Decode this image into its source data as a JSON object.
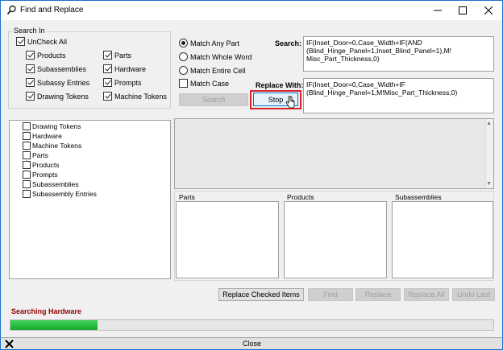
{
  "window": {
    "title": "Find and Replace"
  },
  "search_in": {
    "legend": "Search In",
    "uncheck_all": "UnCheck All",
    "items": [
      {
        "label": "Products",
        "checked": true
      },
      {
        "label": "Subassemblies",
        "checked": true
      },
      {
        "label": "Subassy Entries",
        "checked": true
      },
      {
        "label": "Drawing Tokens",
        "checked": true
      },
      {
        "label": "Parts",
        "checked": true
      },
      {
        "label": "Hardware",
        "checked": true
      },
      {
        "label": "Prompts",
        "checked": true
      },
      {
        "label": "Machine Tokens",
        "checked": true
      }
    ]
  },
  "match_options": {
    "radios": [
      {
        "label": "Match Any Part",
        "checked": true
      },
      {
        "label": "Match Whole Word",
        "checked": false
      },
      {
        "label": "Match Entire Cell",
        "checked": false
      }
    ],
    "match_case": "Match Case"
  },
  "buttons": {
    "search": "Search",
    "stop": "Stop",
    "replace_checked": "Replace Checked Items",
    "find": "Find",
    "replace": "Replace",
    "replace_all": "Replace All",
    "undo_last": "Undo Last",
    "close": "Close"
  },
  "search": {
    "label": "Search:",
    "value_lines": [
      "IF(Inset_Door=0,Case_Width+IF(AND",
      "(Blind_Hinge_Panel=1,Inset_Blind_Panel=1),M!",
      "Misc_Part_Thickness,0)"
    ]
  },
  "replace_with": {
    "label": "Replace With:",
    "value_lines": [
      "IF(Inset_Door=0,Case_Width+IF",
      "(Blind_Hinge_Panel=1,M!Misc_Part_Thickness,0)"
    ]
  },
  "tree": {
    "items": [
      "Drawing Tokens",
      "Hardware",
      "Machine Tokens",
      "Parts",
      "Products",
      "Prompts",
      "Subassemblies",
      "Subassembly Entries"
    ]
  },
  "lists": {
    "parts": "Parts",
    "products": "Products",
    "subassemblies": "Subassemblies"
  },
  "status": {
    "text": "Searching Hardware",
    "color": "#8b0000",
    "progress": 0.18,
    "progress_color": "#1fbf3a"
  }
}
